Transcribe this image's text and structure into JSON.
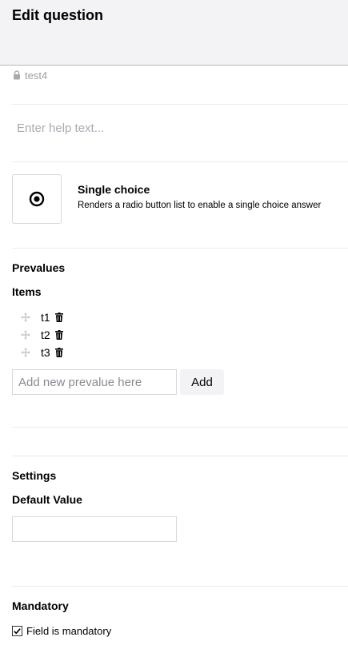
{
  "header": {
    "title": "Edit question"
  },
  "alias": {
    "value": "test4"
  },
  "help_text": {
    "placeholder": "Enter help text...",
    "value": ""
  },
  "question_type": {
    "name": "Single choice",
    "description": "Renders a radio button list to enable a single choice answer",
    "icon": "radio-target-icon"
  },
  "prevalues": {
    "heading": "Prevalues",
    "items_heading": "Items",
    "items": [
      {
        "label": "t1"
      },
      {
        "label": "t2"
      },
      {
        "label": "t3"
      }
    ],
    "new_placeholder": "Add new prevalue here",
    "add_label": "Add"
  },
  "settings": {
    "heading": "Settings",
    "default_value_label": "Default Value",
    "default_value": ""
  },
  "mandatory": {
    "heading": "Mandatory",
    "checkbox_label": "Field is mandatory",
    "checked": true
  },
  "colors": {
    "header_bg": "#f3f3f5",
    "divider": "#ececee",
    "muted_text": "#9e9e9e",
    "icon_gray": "#c8c8cc"
  }
}
